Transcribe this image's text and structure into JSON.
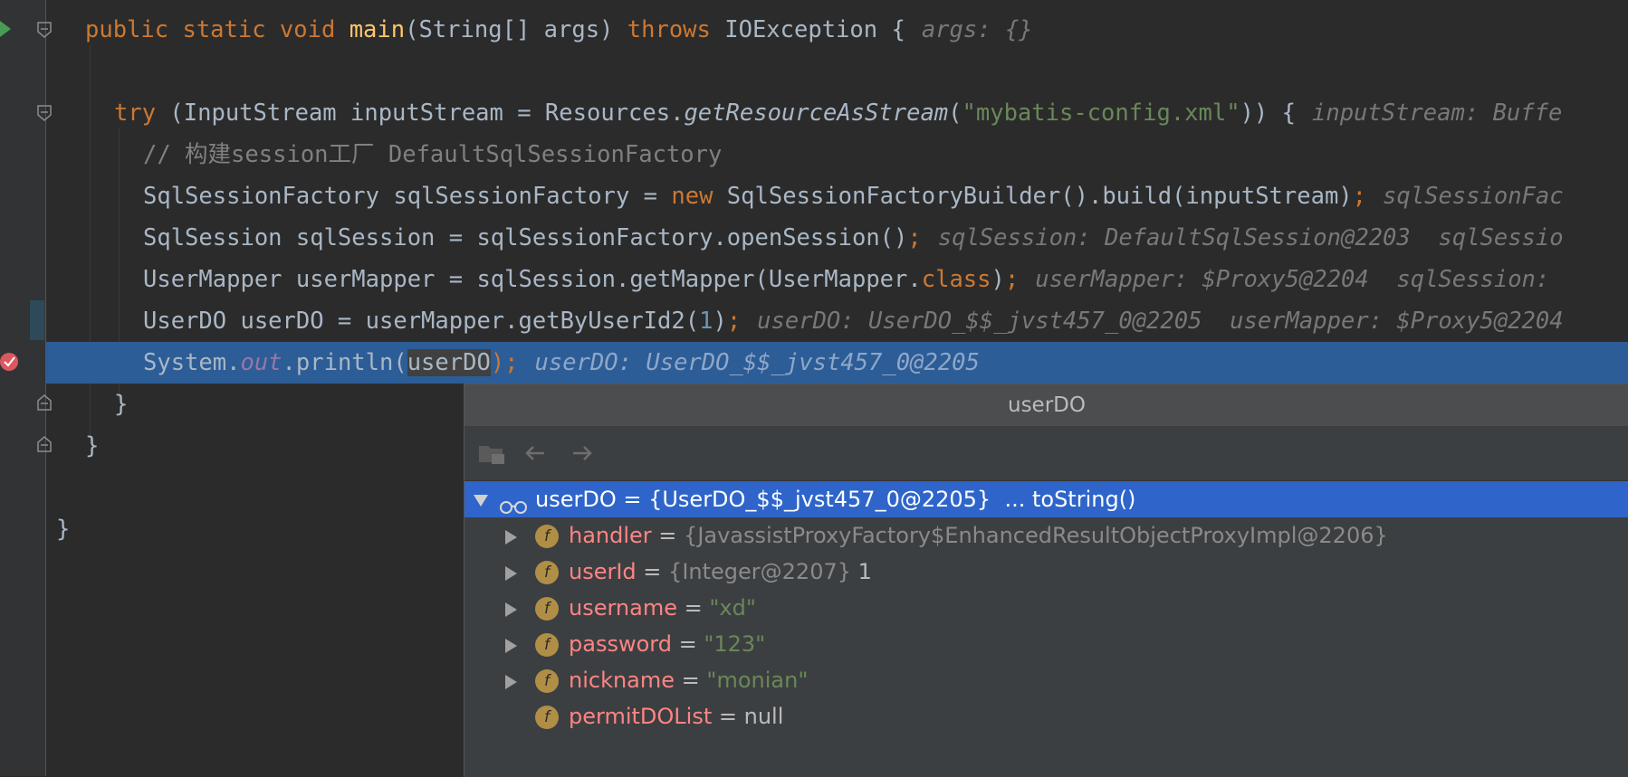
{
  "code": {
    "l1": {
      "a": "public static void ",
      "b": "main",
      "c": "(String[] args) ",
      "d": "throws",
      "e": " IOException {",
      "hint": "args: {}"
    },
    "l3": {
      "a": "try",
      "b": " (InputStream inputStream = Resources.",
      "c": "getResourceAsStream",
      "d": "(",
      "e": "\"mybatis-config.xml\"",
      "f": ")) {",
      "hint": "inputStream: Buffe"
    },
    "l4": {
      "a": "// 构建session工厂 DefaultSqlSessionFactory"
    },
    "l5": {
      "a": "SqlSessionFactory sqlSessionFactory = ",
      "b": "new",
      "c": " SqlSessionFactoryBuilder().build(inputStream)",
      "d": ";",
      "hint": "sqlSessionFac"
    },
    "l6": {
      "a": "SqlSession sqlSession = sqlSessionFactory.openSession()",
      "b": ";",
      "hint": "sqlSession: DefaultSqlSession@2203  sqlSessio"
    },
    "l7": {
      "a": "UserMapper userMapper = sqlSession.getMapper(UserMapper.",
      "b": "class",
      "c": ")",
      "d": ";",
      "hint": "userMapper: $Proxy5@2204  sqlSession:"
    },
    "l8": {
      "a": "UserDO userDO = userMapper.getByUserId2(",
      "b": "1",
      "c": ")",
      "d": ";",
      "hint": "userDO: UserDO_$$_jvst457_0@2205  userMapper: $Proxy5@2204"
    },
    "l9": {
      "a": "System.",
      "b": "out",
      "c": ".println(",
      "d": "userDO",
      "e": ");",
      "hint": "userDO: UserDO_$$_jvst457_0@2205"
    },
    "l10": {
      "a": "}"
    },
    "l11": {
      "a": "}"
    },
    "l13": {
      "a": "}"
    }
  },
  "popup": {
    "title": "userDO",
    "root": {
      "label": "userDO = {UserDO_$$_jvst457_0@2205}",
      "action": "... toString()"
    },
    "fields": [
      {
        "name": "handler",
        "eq": " = ",
        "type": "{JavassistProxyFactory$EnhancedResultObjectProxyImpl@2206}",
        "value": ""
      },
      {
        "name": "userId",
        "eq": " = ",
        "type": "{Integer@2207}",
        "value": " 1"
      },
      {
        "name": "username",
        "eq": " = ",
        "type": "",
        "value": "\"xd\""
      },
      {
        "name": "password",
        "eq": " = ",
        "type": "",
        "value": "\"123\""
      },
      {
        "name": "nickname",
        "eq": " = ",
        "type": "",
        "value": "\"monian\""
      },
      {
        "name": "permitDOList",
        "eq": " = ",
        "type": "",
        "value": "null"
      }
    ],
    "field_icon": "f"
  },
  "icons": [
    "run-arrow-icon",
    "fold-icon",
    "breakpoint-icon",
    "folder-icon",
    "back-arrow-icon",
    "forward-arrow-icon",
    "expand-arrow-icon",
    "watch-glasses-icon",
    "field-icon"
  ]
}
